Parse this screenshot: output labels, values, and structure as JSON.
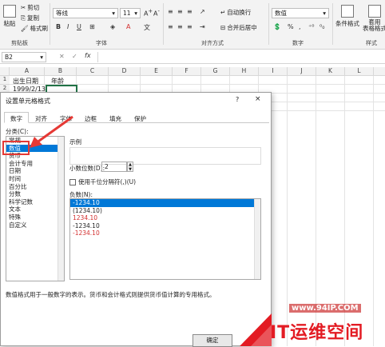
{
  "ribbon": {
    "clipboard": {
      "paste": "粘贴",
      "cut": "剪切",
      "copy": "复制",
      "painter": "格式刷",
      "group": "剪贴板"
    },
    "font": {
      "name": "等线",
      "size": "11",
      "group": "字体",
      "bold": "B",
      "italic": "I",
      "underline": "U"
    },
    "alignment": {
      "wrap": "自动换行",
      "merge": "合并后居中",
      "group": "对齐方式"
    },
    "number": {
      "format": "数值",
      "percent": "%",
      "comma": ",",
      "group": "数字"
    },
    "styles": {
      "conditional": "条件格式",
      "table": "套用\n表格格式",
      "group": "样式"
    }
  },
  "formula_bar": {
    "name_box": "B2",
    "fx": "fx"
  },
  "columns": [
    "A",
    "B",
    "C",
    "D",
    "E",
    "F",
    "G",
    "H",
    "I",
    "J",
    "K",
    "L",
    "M"
  ],
  "rows": [
    "1",
    "2"
  ],
  "cells": {
    "a1": "出生日期",
    "b1": "年龄",
    "a2": "1999/2/13"
  },
  "dialog": {
    "title": "设置单元格格式",
    "help": "?",
    "close": "×",
    "tabs": [
      "数字",
      "对齐",
      "字体",
      "边框",
      "填充",
      "保护"
    ],
    "category_label": "分类(C):",
    "categories": [
      "常规",
      "数值",
      "货币",
      "会计专用",
      "日期",
      "时间",
      "百分比",
      "分数",
      "科学记数",
      "文本",
      "特殊",
      "自定义"
    ],
    "example_label": "示例",
    "decimals_label": "小数位数(D):",
    "decimals_value": "2",
    "thousands_label": "使用千位分隔符(,)(U)",
    "negative_label": "负数(N):",
    "negatives": [
      "-1234.10",
      "(1234.10)",
      "1234.10",
      "-1234.10",
      "-1234.10"
    ],
    "description": "数值格式用于一般数字的表示。货币和会计格式则提供货币值计算的专用格式。",
    "ok": "确定"
  },
  "watermark": {
    "url": "www.94IP.COM",
    "brand": "IT运维空间"
  }
}
